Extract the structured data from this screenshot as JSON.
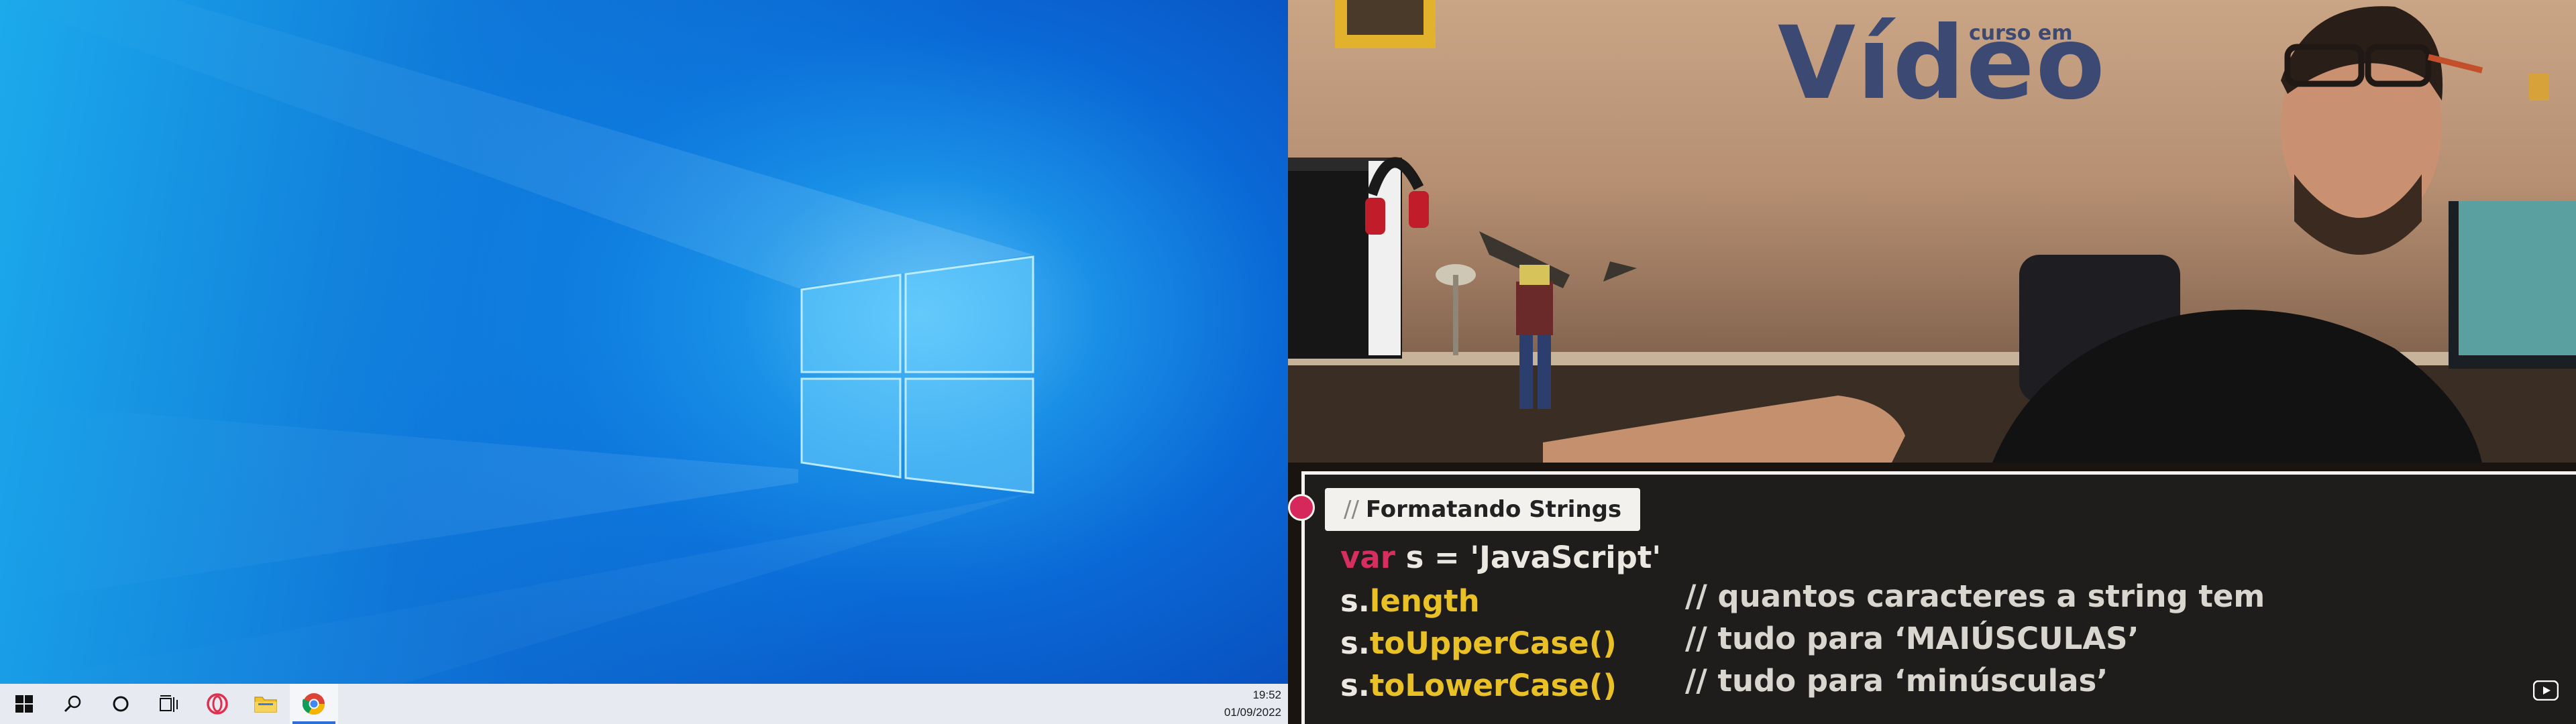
{
  "taskbar": {
    "items": [
      {
        "name": "start-button",
        "icon": "windows-icon"
      },
      {
        "name": "search-button",
        "icon": "search-icon"
      },
      {
        "name": "cortana-button",
        "icon": "cortana-icon"
      },
      {
        "name": "task-view-button",
        "icon": "task-view-icon"
      },
      {
        "name": "opera-app",
        "icon": "opera-icon"
      },
      {
        "name": "file-explorer-app",
        "icon": "folder-icon"
      },
      {
        "name": "chrome-app",
        "icon": "chrome-icon",
        "active": true
      }
    ],
    "clock": {
      "time": "19:52",
      "date": "01/09/2022"
    }
  },
  "video": {
    "brand": {
      "small": "curso em",
      "large": "Vídeo"
    },
    "code": {
      "title_slashes": "//",
      "title": "Formatando Strings",
      "line1": {
        "keyword": "var",
        "rest": " s = 'JavaScript'"
      },
      "lines": [
        {
          "obj": "s.",
          "member": "length",
          "comment": "// quantos caracteres a string tem"
        },
        {
          "obj": "s.",
          "member": "toUpperCase()",
          "comment": "// tudo para ‘MAIÚSCULAS’"
        },
        {
          "obj": "s.",
          "member": "toLowerCase()",
          "comment": "// tudo para ‘minúsculas’"
        }
      ]
    }
  },
  "colors": {
    "accent_blue": "#0a69d6",
    "code_keyword": "#d62e5e",
    "code_member": "#e9c126",
    "code_bg": "#1e1d1b"
  }
}
